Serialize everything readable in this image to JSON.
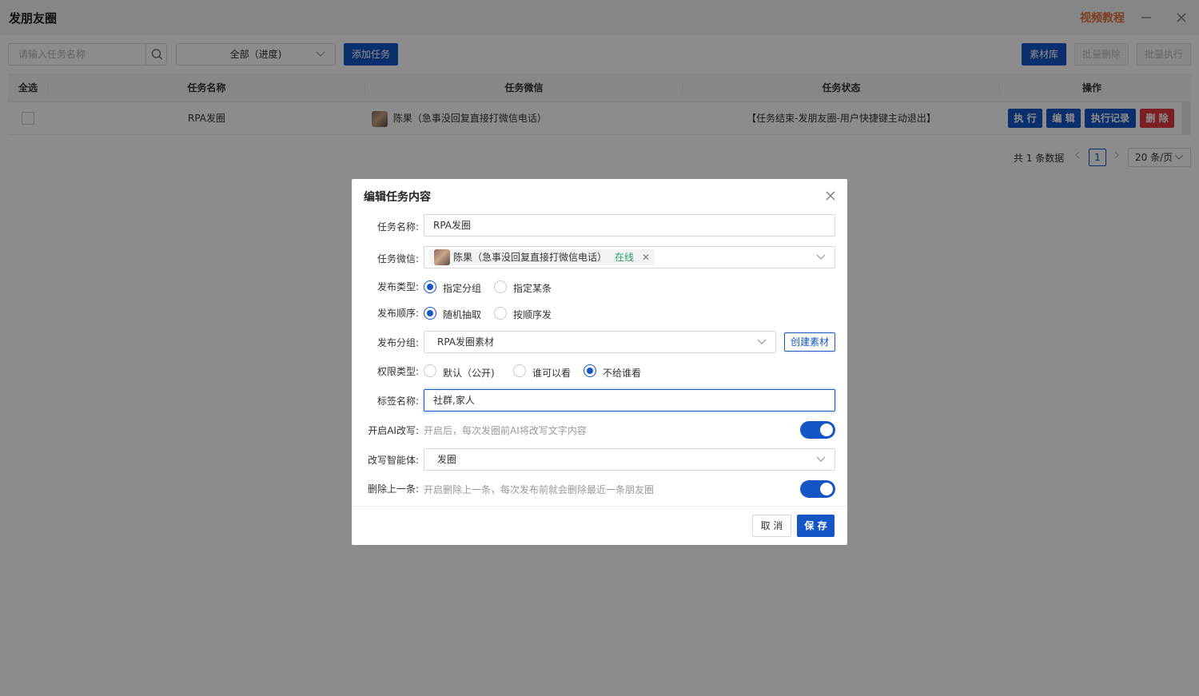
{
  "window": {
    "title": "发朋友圈",
    "tutorial_link": "视频教程"
  },
  "toolbar": {
    "search_placeholder": "请输入任务名称",
    "progress_filter": "全部（进度)",
    "add_task": "添加任务",
    "material_library": "素材库",
    "batch_delete": "批量删除",
    "batch_execute": "批量执行"
  },
  "table": {
    "headers": {
      "select_all": "全选",
      "task_name": "任务名称",
      "task_wechat": "任务微信",
      "task_status": "任务状态",
      "actions": "操作"
    },
    "rows": [
      {
        "task_name": "RPA发圈",
        "wechat": "陈果（急事没回复直接打微信电话）",
        "status": "【任务结束-发朋友圈-用户快捷键主动退出】",
        "actions": {
          "execute": "执 行",
          "edit": "编 辑",
          "log": "执行记录",
          "delete": "删 除"
        }
      }
    ]
  },
  "pagination": {
    "total_text": "共 1 条数据",
    "current_page": "1",
    "page_size": "20 条/页"
  },
  "dialog": {
    "title": "编辑任务内容",
    "fields": {
      "task_name": {
        "label": "任务名称:",
        "value": "RPA发圈"
      },
      "task_wechat": {
        "label": "任务微信:",
        "tag_name": "陈果（急事没回复直接打微信电话）",
        "tag_status": "在线"
      },
      "publish_type": {
        "label": "发布类型:",
        "options": [
          "指定分组",
          "指定某条"
        ],
        "selected": "指定分组"
      },
      "publish_order": {
        "label": "发布顺序:",
        "options": [
          "随机抽取",
          "按顺序发"
        ],
        "selected": "随机抽取"
      },
      "publish_group": {
        "label": "发布分组:",
        "value": "RPA发圈素材",
        "create_button": "创建素材"
      },
      "permission_type": {
        "label": "权限类型:",
        "options": [
          "默认（公开)",
          "谁可以看",
          "不给谁看"
        ],
        "selected": "不给谁看"
      },
      "tag_name": {
        "label": "标签名称:",
        "value": "社群,家人"
      },
      "ai_rewrite": {
        "label": "开启AI改写:",
        "hint": "开启后，每次发圈前AI将改写文字内容",
        "enabled": true
      },
      "rewrite_agent": {
        "label": "改写智能体:",
        "value": "发圈"
      },
      "delete_previous": {
        "label": "删除上一条:",
        "hint": "开启删除上一条，每次发布前就会删除最近一条朋友圈",
        "enabled": true
      }
    },
    "cancel": "取 消",
    "save": "保 存"
  },
  "colors": {
    "primary": "#1556c6",
    "danger": "#e0393e",
    "tutorial": "#e8743b",
    "online": "#27a15a"
  }
}
